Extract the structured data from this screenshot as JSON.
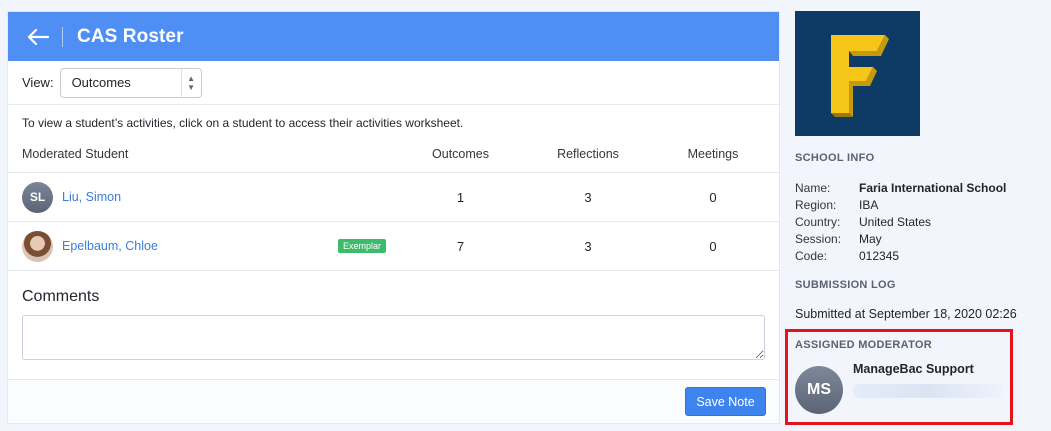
{
  "header": {
    "title": "CAS Roster"
  },
  "view": {
    "label": "View:",
    "selected": "Outcomes"
  },
  "info_text": "To view a student’s activities, click on a student to access their activities worksheet.",
  "table": {
    "headers": [
      "Moderated Student",
      "Outcomes",
      "Reflections",
      "Meetings"
    ],
    "rows": [
      {
        "initials": "SL",
        "name": "Liu, Simon",
        "badge": "",
        "outcomes": "1",
        "reflections": "3",
        "meetings": "0"
      },
      {
        "initials": "",
        "name": "Epelbaum, Chloe",
        "badge": "Exemplar",
        "outcomes": "7",
        "reflections": "3",
        "meetings": "0"
      }
    ]
  },
  "comments": {
    "title": "Comments",
    "save_label": "Save Note"
  },
  "school_info": {
    "title": "SCHOOL INFO",
    "fields": [
      {
        "key": "Name:",
        "value": "Faria International School"
      },
      {
        "key": "Region:",
        "value": "IBA"
      },
      {
        "key": "Country:",
        "value": "United States"
      },
      {
        "key": "Session:",
        "value": "May"
      },
      {
        "key": "Code:",
        "value": "012345"
      }
    ]
  },
  "submission_log": {
    "title": "SUBMISSION LOG",
    "text": "Submitted at September 18, 2020 02:26"
  },
  "moderator": {
    "title": "ASSIGNED MODERATOR",
    "initials": "MS",
    "name": "ManageBac Support"
  },
  "colors": {
    "header": "#4f8ff3",
    "link": "#3b7ddd",
    "badge": "#3dbb6a",
    "highlight": "#e3151b",
    "logo_bg": "#0e3a66",
    "logo_fg": "#f5c518"
  }
}
